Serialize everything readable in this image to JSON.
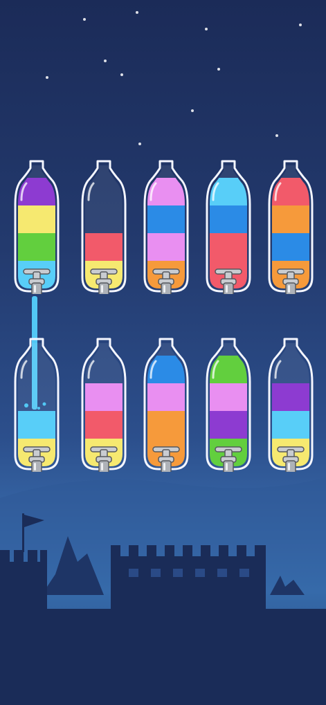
{
  "level": {
    "bottles": [
      {
        "id": "bottle-1",
        "row": 1,
        "layers": [
          "#8d3bd1",
          "#f6e970",
          "#62cf3e",
          "#58cef8"
        ],
        "pouring": true
      },
      {
        "id": "bottle-2",
        "row": 1,
        "layers": [
          "#f25a6a",
          "#f6e970"
        ],
        "pouring": false
      },
      {
        "id": "bottle-3",
        "row": 1,
        "layers": [
          "#e98ff1",
          "#2b8be6",
          "#e98ff1",
          "#f69a3b"
        ],
        "pouring": false
      },
      {
        "id": "bottle-4",
        "row": 1,
        "layers": [
          "#58cef8",
          "#2b8be6",
          "#f25a6a",
          "#f25a6a"
        ],
        "pouring": false
      },
      {
        "id": "bottle-5",
        "row": 1,
        "layers": [
          "#f25a6a",
          "#f69a3b",
          "#2b8be6",
          "#f69a3b"
        ],
        "pouring": false
      },
      {
        "id": "bottle-6",
        "row": 2,
        "layers": [
          "#58cef8",
          "#f6e970"
        ],
        "pouring": false,
        "receiving": true
      },
      {
        "id": "bottle-7",
        "row": 2,
        "layers": [
          "#e98ff1",
          "#f25a6a",
          "#f6e970"
        ],
        "pouring": false
      },
      {
        "id": "bottle-8",
        "row": 2,
        "layers": [
          "#2b8be6",
          "#e98ff1",
          "#f69a3b",
          "#f69a3b"
        ],
        "pouring": false
      },
      {
        "id": "bottle-9",
        "row": 2,
        "layers": [
          "#62cf3e",
          "#e98ff1",
          "#8d3bd1",
          "#62cf3e"
        ],
        "pouring": false
      },
      {
        "id": "bottle-10",
        "row": 2,
        "layers": [
          "#8d3bd1",
          "#58cef8",
          "#f6e970"
        ],
        "pouring": false
      }
    ],
    "stream_color": "#52c8f5"
  },
  "icons": {
    "tap": "faucet-icon",
    "flag": "flag-icon"
  },
  "theme": {
    "sky_top": "#1b2b58",
    "horizon": "#3e7fc0",
    "silhouette": "#1a2c58",
    "tap_metal": "#c9ccd1"
  }
}
